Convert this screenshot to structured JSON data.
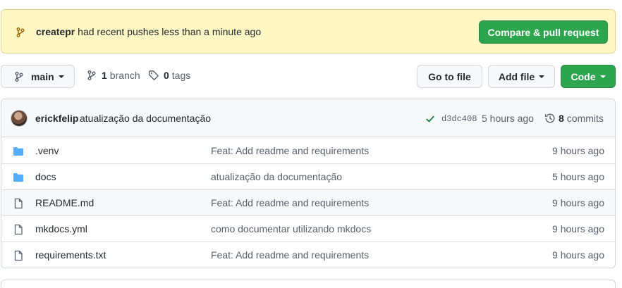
{
  "banner": {
    "branch_name": "createpr",
    "message": "had recent pushes less than a minute ago",
    "compare_label": "Compare & pull request"
  },
  "toolbar": {
    "branch_selector_label": "main",
    "branch_count": "1",
    "branch_label": "branch",
    "tag_count": "0",
    "tag_label": "tags",
    "go_to_file_label": "Go to file",
    "add_file_label": "Add file",
    "code_label": "Code"
  },
  "latest_commit": {
    "author": "erickfelip",
    "message": "atualização da documentação",
    "sha": "d3dc408",
    "time": "5 hours ago",
    "commit_count": "8",
    "commits_label": "commits"
  },
  "files": [
    {
      "type": "folder-icon",
      "name": ".venv",
      "message": "Feat: Add readme and requirements",
      "time": "9 hours ago"
    },
    {
      "type": "folder-icon",
      "name": "docs",
      "message": "atualização da documentação",
      "time": "5 hours ago"
    },
    {
      "type": "file-icon",
      "name": "README.md",
      "message": "Feat: Add readme and requirements",
      "time": "9 hours ago"
    },
    {
      "type": "file-icon",
      "name": "mkdocs.yml",
      "message": "como documentar utilizando mkdocs",
      "time": "9 hours ago"
    },
    {
      "type": "file-icon",
      "name": "requirements.txt",
      "message": "Feat: Add readme and requirements",
      "time": "9 hours ago"
    }
  ],
  "colors": {
    "banner_bg": "#fff8c5",
    "primary_green": "#2da44e",
    "folder_blue": "#54aeff",
    "muted_text": "#57606a"
  }
}
